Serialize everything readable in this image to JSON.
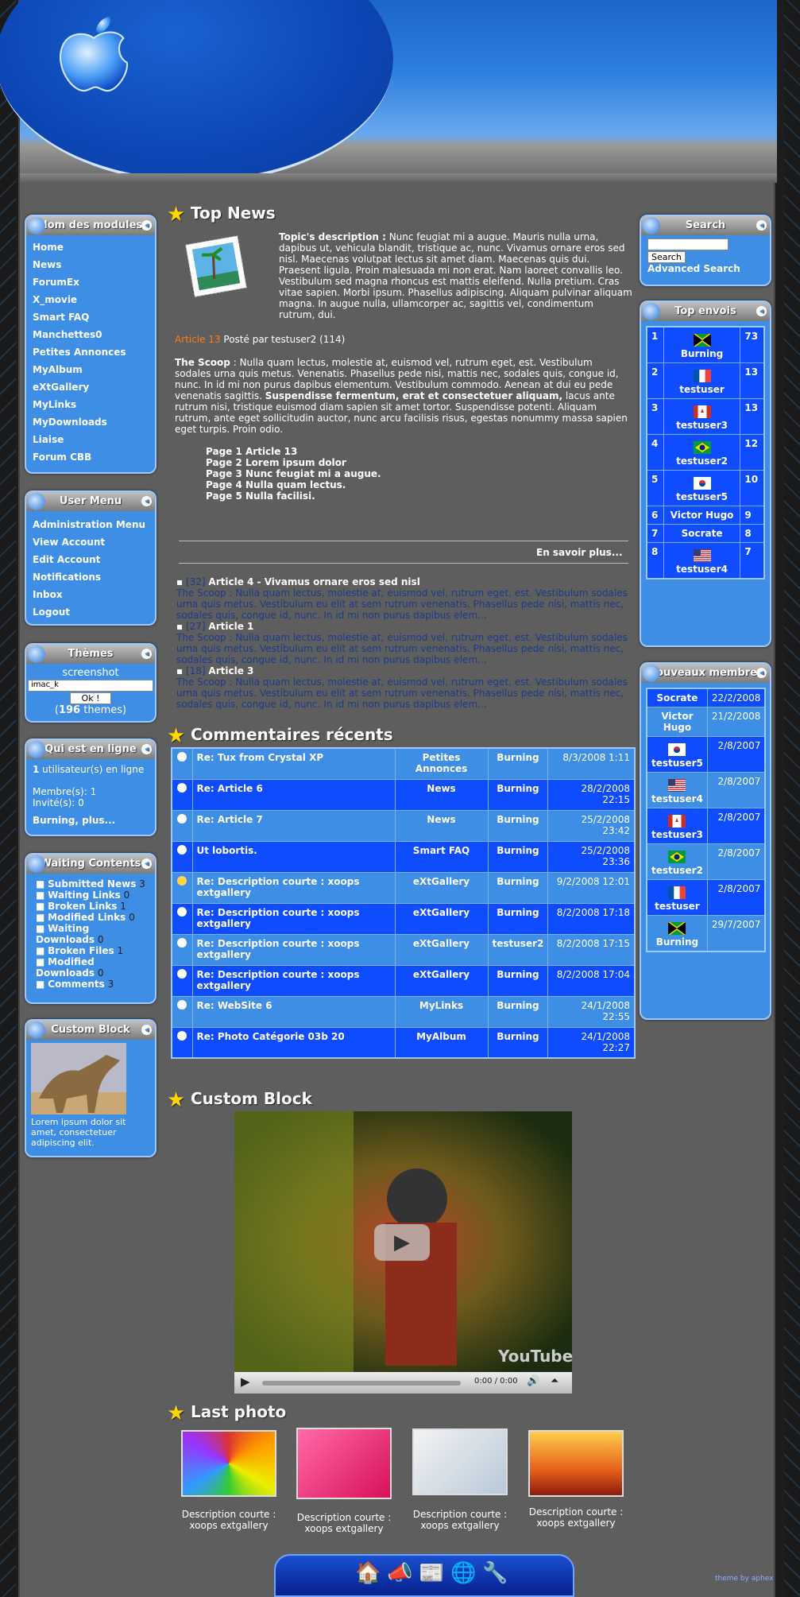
{
  "left": {
    "modules": {
      "title": "Nom des modules",
      "items": [
        "Home",
        "News",
        "ForumEx",
        "X_movie",
        "Smart FAQ",
        "Manchettes0",
        "Petites Annonces",
        "MyAlbum",
        "eXtGallery",
        "MyLinks",
        "MyDownloads",
        "Liaise",
        "Forum CBB"
      ]
    },
    "user_menu": {
      "title": "User Menu",
      "items": [
        "Administration Menu",
        "View Account",
        "Edit Account",
        "Notifications",
        "Inbox",
        "Logout"
      ]
    },
    "themes": {
      "title": "Thèmes",
      "screenshot": "screenshot",
      "select": "imac_k",
      "ok": "Ok !",
      "count": "196",
      "count_suffix": " themes"
    },
    "online": {
      "title": "Qui est en ligne",
      "count": "1",
      "online_text": " utilisateur(s) en ligne",
      "members": "Membre(s): 1",
      "guests": "Invité(s): 0",
      "who": "Burning, plus..."
    },
    "waiting": {
      "title": "Waiting Contents",
      "items": [
        {
          "label": "Submitted News",
          "count": "3"
        },
        {
          "label": "Waiting Links",
          "count": "0"
        },
        {
          "label": "Broken Links",
          "count": "1"
        },
        {
          "label": "Modified Links",
          "count": "0"
        },
        {
          "label": "Waiting Downloads",
          "count": "0"
        },
        {
          "label": "Broken Files",
          "count": "1"
        },
        {
          "label": "Modified Downloads",
          "count": "0"
        },
        {
          "label": "Comments",
          "count": "3"
        }
      ]
    },
    "custom": {
      "title": "Custom Block",
      "text": "Lorem ipsum dolor sit amet, consectetuer adipiscing elit."
    }
  },
  "right": {
    "search": {
      "title": "Search",
      "button": "Search",
      "advanced": "Advanced Search"
    },
    "top": {
      "title": "Top envois",
      "rows": [
        {
          "rank": "1",
          "name": "Burning",
          "count": "73",
          "flag": "jamaica"
        },
        {
          "rank": "2",
          "name": "testuser",
          "count": "13",
          "flag": "france"
        },
        {
          "rank": "3",
          "name": "testuser3",
          "count": "13",
          "flag": "canada"
        },
        {
          "rank": "4",
          "name": "testuser2",
          "count": "12",
          "flag": "brazil"
        },
        {
          "rank": "5",
          "name": "testuser5",
          "count": "10",
          "flag": "korea"
        },
        {
          "rank": "6",
          "name": "Victor Hugo",
          "count": "9",
          "flag": ""
        },
        {
          "rank": "7",
          "name": "Socrate",
          "count": "8",
          "flag": ""
        },
        {
          "rank": "8",
          "name": "testuser4",
          "count": "7",
          "flag": "usa"
        }
      ]
    },
    "newm": {
      "title": "Nouveaux membres",
      "rows": [
        {
          "name": "Socrate",
          "date": "22/2/2008",
          "flag": ""
        },
        {
          "name": "Victor Hugo",
          "date": "21/2/2008",
          "flag": ""
        },
        {
          "name": "testuser5",
          "date": "2/8/2007",
          "flag": "korea"
        },
        {
          "name": "testuser4",
          "date": "2/8/2007",
          "flag": "usa"
        },
        {
          "name": "testuser3",
          "date": "2/8/2007",
          "flag": "canada"
        },
        {
          "name": "testuser2",
          "date": "2/8/2007",
          "flag": "brazil"
        },
        {
          "name": "testuser",
          "date": "2/8/2007",
          "flag": "france"
        },
        {
          "name": "Burning",
          "date": "29/7/2007",
          "flag": "jamaica"
        }
      ]
    }
  },
  "main": {
    "top_news": {
      "title": "Top News",
      "desc_label": "Topic's description :",
      "desc": " Nunc feugiat mi a augue. Mauris nulla urna, dapibus ut, vehicula blandit, tristique ac, nunc. Vivamus ornare eros sed nisl. Maecenas volutpat lectus sit amet diam. Maecenas quis dui. Praesent ligula. Proin malesuada mi non erat. Nam laoreet convallis leo. Vestibulum sed magna rhoncus est mattis eleifend. Nulla pretium. Cras vitae sapien. Morbi ipsum. Phasellus adipiscing. Aliquam pulvinar aliquam magna. In augue nulla, ullamcorper ac, sagittis vel, condimentum rutrum, dui.",
      "article_link": "Article 13",
      "posted": " Posté par testuser2 (114)",
      "scoop_label": "The Scoop",
      "scoop": " : Nulla quam lectus, molestie at, euismod vel, rutrum eget, est. Vestibulum sodales urna quis metus. Venenatis. Phasellus pede nisi, mattis nec, sodales quis, congue id, nunc. In id mi non purus dapibus elementum. Vestibulum commodo. Aenean at dui eu pede venenatis sagittis. ",
      "scoop_bold": "Suspendisse fermentum, erat et consectetuer aliquam,",
      "scoop_end": " lacus ante rutrum nisi, tristique euismod diam sapien sit amet tortor. Suspendisse potenti. Aliquam rutrum, ante eget sollicitudin auctor, nunc arcu facilisis risus, egestas nonummy massa sapien eget turpis. Proin odio.",
      "pages": [
        "Page 1 Article 13",
        "Page 2 Lorem ipsum dolor",
        "Page 3 Nunc feugiat mi a augue.",
        "Page 4 Nulla quam lectus.",
        "Page 5 Nulla facilisi."
      ],
      "more": "En savoir plus...",
      "others": [
        {
          "id": "[32]",
          "title": "Article 4 - Vivamus ornare eros sed nisl",
          "text": "The Scoop : Nulla quam lectus, molestie at, euismod vel, rutrum eget, est. Vestibulum sodales urna quis metus. Vestibulum eu elit at sem rutrum venenatis. Phasellus pede nisi, mattis nec, sodales quis, congue id, nunc. In id mi non purus dapibus elem..."
        },
        {
          "id": "[27]",
          "title": "Article 1",
          "text": "The Scoop : Nulla quam lectus, molestie at, euismod vel, rutrum eget, est. Vestibulum sodales urna quis metus. Vestibulum eu elit at sem rutrum venenatis. Phasellus pede nisi, mattis nec, sodales quis, congue id, nunc. In id mi non purus dapibus elem..."
        },
        {
          "id": "[18]",
          "title": "Article 3",
          "text": "The Scoop : Nulla quam lectus, molestie at, euismod vel, rutrum eget, est. Vestibulum sodales urna quis metus. Vestibulum eu elit at sem rutrum venenatis. Phasellus pede nisi, mattis nec, sodales quis, congue id, nunc. In id mi non purus dapibus elem..."
        }
      ]
    },
    "comments": {
      "title": "Commentaires récents",
      "rows": [
        [
          "Re: Tux from Crystal XP",
          "Petites Annonces",
          "Burning",
          "8/3/2008 1:11"
        ],
        [
          "Re: Article 6",
          "News",
          "Burning",
          "28/2/2008 22:15"
        ],
        [
          "Re: Article 7",
          "News",
          "Burning",
          "25/2/2008 23:42"
        ],
        [
          "Ut lobortis.",
          "Smart FAQ",
          "Burning",
          "25/2/2008 23:36"
        ],
        [
          "Re: Description courte : xoops extgallery",
          "eXtGallery",
          "Burning",
          "9/2/2008 12:01"
        ],
        [
          "Re: Description courte : xoops extgallery",
          "eXtGallery",
          "Burning",
          "8/2/2008 17:18"
        ],
        [
          "Re: Description courte : xoops extgallery",
          "eXtGallery",
          "testuser2",
          "8/2/2008 17:15"
        ],
        [
          "Re: Description courte : xoops extgallery",
          "eXtGallery",
          "Burning",
          "8/2/2008 17:04"
        ],
        [
          "Re: WebSite 6",
          "MyLinks",
          "Burning",
          "24/1/2008 22:55"
        ],
        [
          "Re: Photo Catégorie 03b 20",
          "MyAlbum",
          "Burning",
          "24/1/2008 22:27"
        ]
      ]
    },
    "custom": {
      "title": "Custom Block",
      "time": "0:00 / 0:00",
      "youtube": "YouTube"
    },
    "photos": {
      "title": "Last photo",
      "caps": [
        "Description courte : xoops extgallery",
        "Description courte : xoops extgallery",
        "Description courte : xoops extgallery",
        "Description courte : xoops extgallery"
      ]
    },
    "credit": "theme by aphex"
  }
}
